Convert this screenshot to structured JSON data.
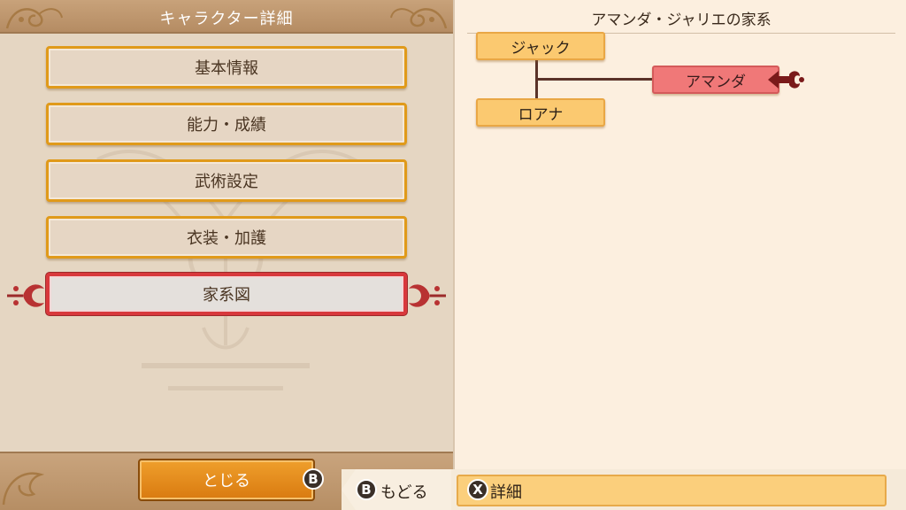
{
  "left_panel": {
    "title": "キャラクター詳細",
    "menu": [
      {
        "label": "基本情報"
      },
      {
        "label": "能力・成績"
      },
      {
        "label": "武術設定"
      },
      {
        "label": "衣装・加護"
      },
      {
        "label": "家系図",
        "selected": true
      }
    ],
    "close_button": {
      "label": "とじる",
      "button_hint": "B"
    }
  },
  "right_panel": {
    "title": "アマンダ・ジャリエの家系",
    "tree": {
      "parents": [
        {
          "name": "ジャック"
        },
        {
          "name": "ロアナ"
        }
      ],
      "child": {
        "name": "アマンダ",
        "selected": true
      }
    }
  },
  "bottom_bar": {
    "back": {
      "button_hint": "B",
      "label": "もどる"
    },
    "detail": {
      "button_hint": "X",
      "label": "詳細"
    }
  },
  "colors": {
    "menu_border": "#e09a1a",
    "selected_border": "#d8383c",
    "node_fill": "#fbc970",
    "node_selected_fill": "#f07878",
    "close_button_fill": "#e48a18"
  }
}
